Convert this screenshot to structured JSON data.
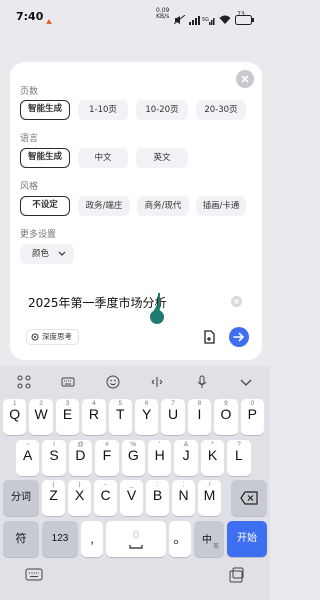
{
  "status": {
    "time": "7:40",
    "net_speed": "0.09",
    "net_unit": "KB/s",
    "battery": "73"
  },
  "panel": {
    "pages": {
      "label": "页数",
      "options": [
        "智能生成",
        "1-10页",
        "10-20页",
        "20-30页"
      ],
      "selected": 0
    },
    "language": {
      "label": "语言",
      "options": [
        "智能生成",
        "中文",
        "英文"
      ],
      "selected": 0
    },
    "style": {
      "label": "风格",
      "options": [
        "不设定",
        "政务/端庄",
        "商务/现代",
        "插画/卡通"
      ],
      "selected": 0
    },
    "more": {
      "label": "更多设置",
      "color_label": "颜色"
    }
  },
  "input": {
    "value": "2025年第一季度市场分析",
    "deep_think_label": "深度思考"
  },
  "keyboard": {
    "row1": [
      {
        "main": "Q",
        "sub": "1"
      },
      {
        "main": "W",
        "sub": "2"
      },
      {
        "main": "E",
        "sub": "3"
      },
      {
        "main": "R",
        "sub": "4"
      },
      {
        "main": "T",
        "sub": "5"
      },
      {
        "main": "Y",
        "sub": "6"
      },
      {
        "main": "U",
        "sub": "7"
      },
      {
        "main": "I",
        "sub": "8"
      },
      {
        "main": "O",
        "sub": "9"
      },
      {
        "main": "P",
        "sub": "0"
      }
    ],
    "row2": [
      {
        "main": "A",
        "sub": "~"
      },
      {
        "main": "S",
        "sub": "!"
      },
      {
        "main": "D",
        "sub": "@"
      },
      {
        "main": "F",
        "sub": "#"
      },
      {
        "main": "G",
        "sub": "%"
      },
      {
        "main": "H",
        "sub": "'"
      },
      {
        "main": "J",
        "sub": "&"
      },
      {
        "main": "K",
        "sub": "*"
      },
      {
        "main": "L",
        "sub": "?"
      }
    ],
    "row3": [
      {
        "main": "Z",
        "sub": "("
      },
      {
        "main": "X",
        "sub": ")"
      },
      {
        "main": "C",
        "sub": "-"
      },
      {
        "main": "V",
        "sub": "_"
      },
      {
        "main": "B",
        "sub": ":"
      },
      {
        "main": "N",
        "sub": ";"
      },
      {
        "main": "M",
        "sub": "/"
      }
    ],
    "fenci_label": "分词",
    "symbol_label": "符",
    "num_label": "123",
    "comma_label": ",",
    "period_label": "。",
    "lang_label": "中",
    "lang_sub_label": "英",
    "enter_label": "开始"
  },
  "colors": {
    "accent": "#3d6ff0",
    "caret": "#1f7a6f"
  }
}
